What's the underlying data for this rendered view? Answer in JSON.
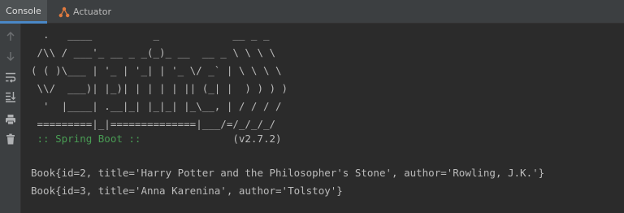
{
  "tabs": {
    "console": "Console",
    "actuator": "Actuator"
  },
  "banner": {
    "line1": "  .   ____          _            __ _ _",
    "line2": " /\\\\ / ___'_ __ _ _(_)_ __  __ _ \\ \\ \\ \\",
    "line3": "( ( )\\___ | '_ | '_| | '_ \\/ _` | \\ \\ \\ \\",
    "line4": " \\\\/  ___)| |_)| | | | | || (_| |  ) ) ) )",
    "line5": "  '  |____| .__|_| |_|_| |_\\__, | / / / /",
    "line6": " =========|_|==============|___/=/_/_/_/",
    "spring_label": " :: Spring Boot :: ",
    "spring_version": "              (v2.7.2)"
  },
  "output": [
    "Book{id=2, title='Harry Potter and the Philosopher's Stone', author='Rowling, J.K.'}",
    "Book{id=3, title='Anna Karenina', author='Tolstoy'}"
  ],
  "colors": {
    "accent": "#4a88c7",
    "spring_green": "#499c54",
    "text": "#bbbbbb",
    "background": "#2b2b2b"
  },
  "gutter_icons": [
    "arrow-up-icon",
    "arrow-down-icon",
    "soft-wrap-icon",
    "scroll-to-end-icon",
    "print-icon",
    "trash-icon"
  ]
}
